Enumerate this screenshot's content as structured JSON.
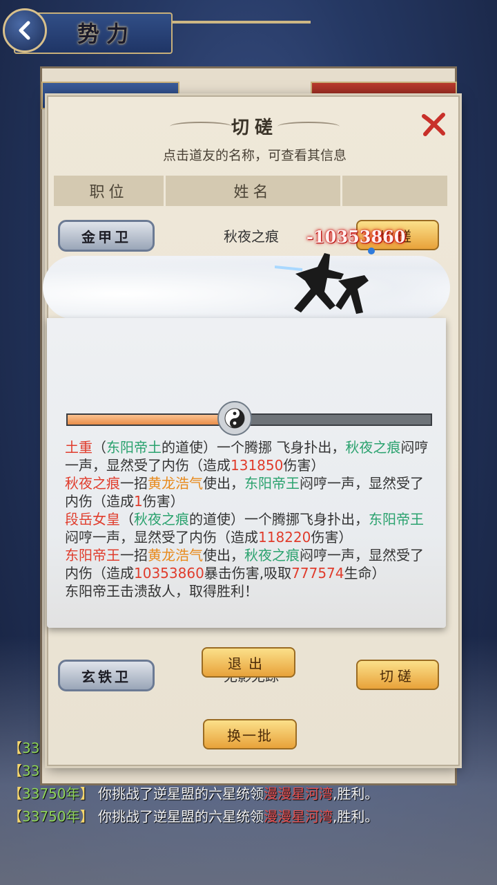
{
  "header": {
    "title": "势力"
  },
  "logs": [
    {
      "open": "【",
      "year": "33",
      "close": "",
      "text": "",
      "target": "",
      "end": ""
    },
    {
      "open": "【",
      "year": "33",
      "close": "",
      "text": "",
      "target": "",
      "end": ""
    },
    {
      "open": "【",
      "year": "33750年",
      "close": "】",
      "text": "你挑战了逆星盟的六星统领",
      "target": "漫漫星河湾",
      "end": ",胜利。"
    },
    {
      "open": "【",
      "year": "33750年",
      "close": "】",
      "text": "你挑战了逆星盟的六星统领",
      "target": "漫漫星河湾",
      "end": ",胜利。"
    }
  ],
  "dialog": {
    "title": "切磋",
    "subtitle": "点击道友的名称，可查看其信息",
    "columns": [
      "职位",
      "姓名",
      ""
    ],
    "rows": [
      {
        "rank": "金甲卫",
        "name": "秋夜之痕",
        "action": "切磋"
      },
      {
        "rank": "玄铁卫",
        "name": "无影无踪",
        "action": "切磋"
      }
    ],
    "refresh_label": "换一批"
  },
  "battle": {
    "damage_popup": "-10353860",
    "hp_ratio": 0.46,
    "log": [
      [
        {
          "t": "土重",
          "c": "r"
        },
        {
          "t": "（",
          "c": ""
        },
        {
          "t": "东阳帝土",
          "c": "g"
        },
        {
          "t": "的道使）一个腾挪 飞身扑出，",
          "c": ""
        },
        {
          "t": "秋夜之痕",
          "c": "g"
        },
        {
          "t": "闷哼一声，显然受了内伤（造成",
          "c": ""
        },
        {
          "t": "131850",
          "c": "r"
        },
        {
          "t": "伤害）",
          "c": ""
        }
      ],
      [
        {
          "t": "秋夜之痕",
          "c": "r"
        },
        {
          "t": "一招",
          "c": ""
        },
        {
          "t": "黄龙浩气",
          "c": "o"
        },
        {
          "t": "使出，",
          "c": ""
        },
        {
          "t": "东阳帝王",
          "c": "g"
        },
        {
          "t": "闷哼一声，显然受了内伤（造成",
          "c": ""
        },
        {
          "t": "1",
          "c": "r"
        },
        {
          "t": "伤害）",
          "c": ""
        }
      ],
      [
        {
          "t": "段岳女皇",
          "c": "r"
        },
        {
          "t": "（",
          "c": ""
        },
        {
          "t": "秋夜之痕",
          "c": "g"
        },
        {
          "t": "的道使）一个腾挪飞身扑出，",
          "c": ""
        },
        {
          "t": "东阳帝王",
          "c": "g"
        },
        {
          "t": "闷哼一声，显然受了内伤（造成",
          "c": ""
        },
        {
          "t": "118220",
          "c": "r"
        },
        {
          "t": "伤害）",
          "c": ""
        }
      ],
      [
        {
          "t": "东阳帝王",
          "c": "r"
        },
        {
          "t": "一招",
          "c": ""
        },
        {
          "t": "黄龙浩气",
          "c": "o"
        },
        {
          "t": "使出，",
          "c": ""
        },
        {
          "t": "秋夜之痕",
          "c": "g"
        },
        {
          "t": "闷哼一声，显然受了内伤（造成",
          "c": ""
        },
        {
          "t": "10353860",
          "c": "r"
        },
        {
          "t": "暴击伤害,吸取",
          "c": ""
        },
        {
          "t": "777574",
          "c": "r"
        },
        {
          "t": "生命）",
          "c": ""
        }
      ],
      [
        {
          "t": "东阳帝王击溃敌人，取得胜利！",
          "c": ""
        }
      ]
    ],
    "exit_label": "退出"
  }
}
